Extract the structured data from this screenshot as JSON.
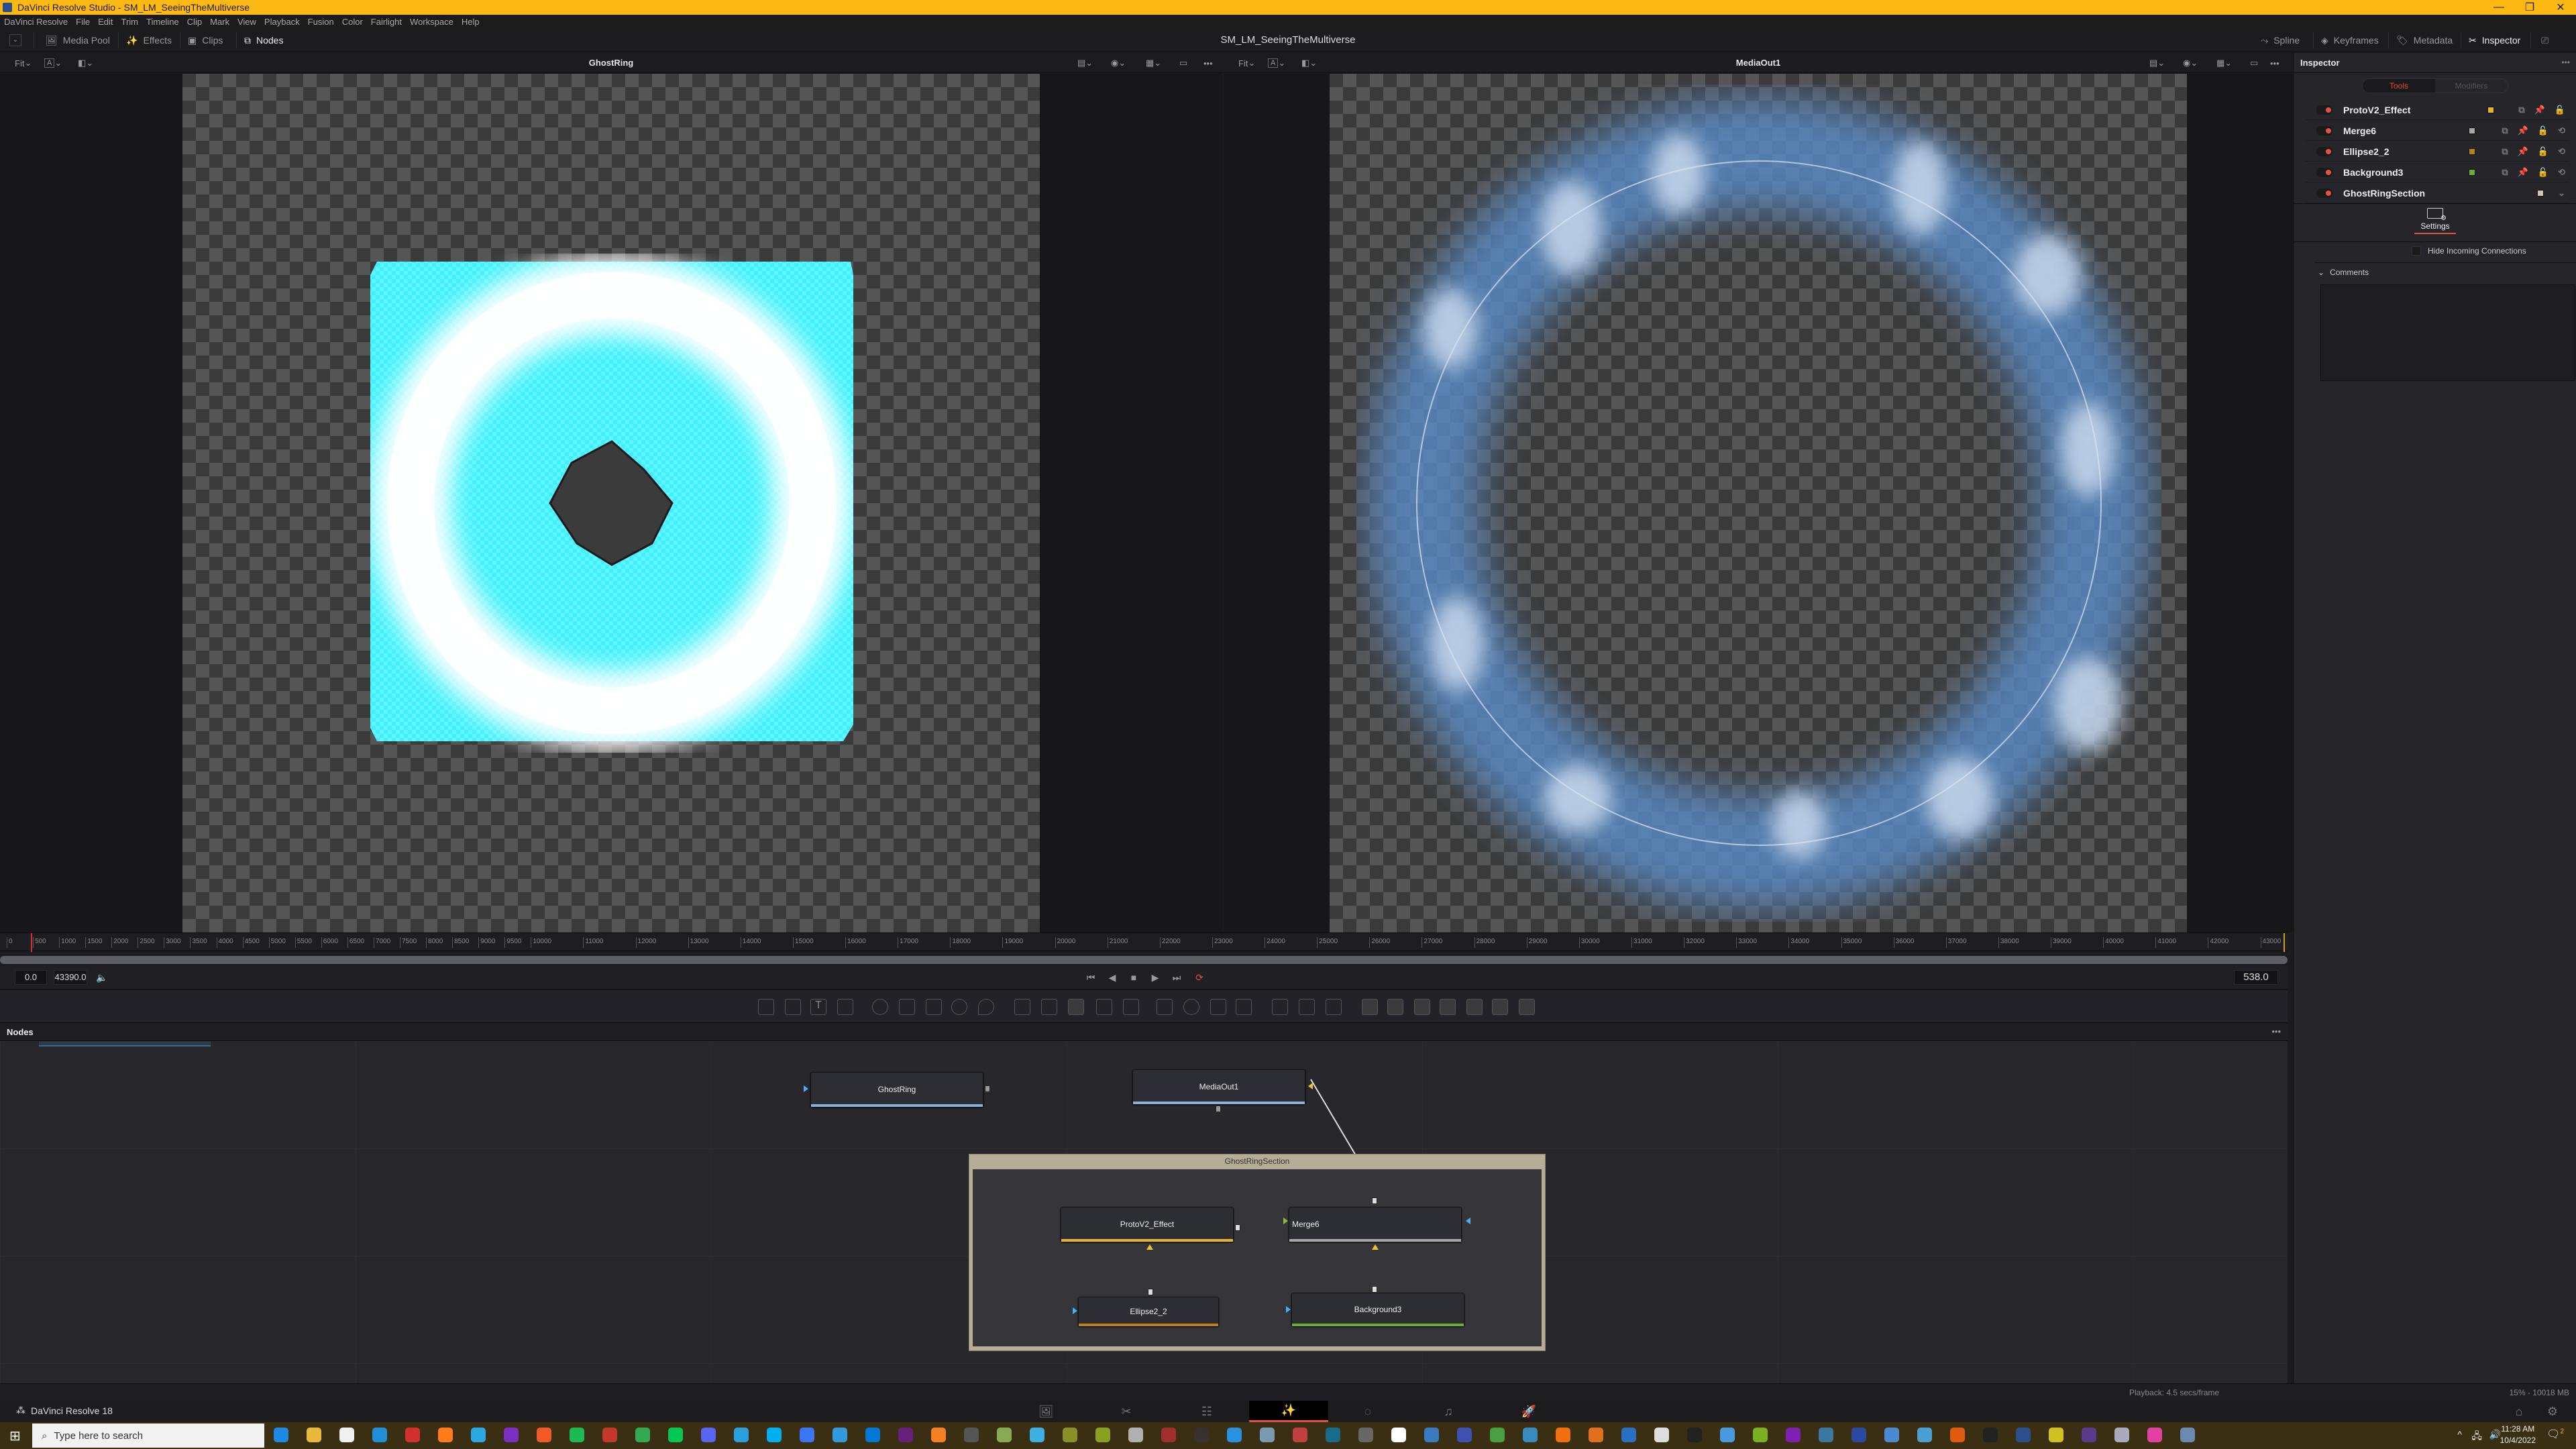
{
  "window": {
    "title": "DaVinci Resolve Studio - SM_LM_SeeingTheMultiverse",
    "minimize": "—",
    "maximize": "❐",
    "close": "✕"
  },
  "menu": [
    "DaVinci Resolve",
    "File",
    "Edit",
    "Trim",
    "Timeline",
    "Clip",
    "Mark",
    "View",
    "Playback",
    "Fusion",
    "Color",
    "Fairlight",
    "Workspace",
    "Help"
  ],
  "toolbar": {
    "media_pool": "Media Pool",
    "effects": "Effects",
    "clips": "Clips",
    "nodes": "Nodes",
    "project_title": "SM_LM_SeeingTheMultiverse",
    "spline": "Spline",
    "keyframes": "Keyframes",
    "metadata": "Metadata",
    "inspector": "Inspector"
  },
  "viewer_left": {
    "title": "GhostRing",
    "fit": "Fit",
    "channel": "A"
  },
  "viewer_right": {
    "title": "MediaOut1",
    "fit": "Fit",
    "channel": "A",
    "more": "•••"
  },
  "ruler": {
    "ticks": [
      "0",
      "500",
      "1000",
      "1500",
      "2000",
      "2500",
      "3000",
      "3500",
      "4000",
      "4500",
      "5000",
      "5500",
      "6000",
      "6500",
      "7000",
      "7500",
      "8000",
      "8500",
      "9000",
      "9500",
      "10000",
      "11000",
      "12000",
      "13000",
      "14000",
      "15000",
      "16000",
      "17000",
      "18000",
      "19000",
      "20000",
      "21000",
      "22000",
      "23000",
      "24000",
      "25000",
      "26000",
      "27000",
      "28000",
      "29000",
      "30000",
      "31000",
      "32000",
      "33000",
      "34000",
      "35000",
      "36000",
      "37000",
      "38000",
      "39000",
      "40000",
      "41000",
      "42000",
      "43000"
    ]
  },
  "transport": {
    "start": "0.0",
    "end": "43390.0",
    "current": "538.0",
    "go_start": "⏮",
    "step_back": "◀",
    "stop": "■",
    "step_fwd": "▶",
    "go_end": "⏭",
    "loop": "⟳"
  },
  "nodes_panel": {
    "title": "Nodes",
    "more": "•••",
    "nodes": [
      {
        "name": "GhostRing"
      },
      {
        "name": "MediaOut1"
      },
      {
        "name": "ProtoV2_Effect"
      },
      {
        "name": "Merge6"
      },
      {
        "name": "Ellipse2_2"
      },
      {
        "name": "Background3"
      }
    ],
    "group": {
      "name": "GhostRingSection"
    }
  },
  "inspector": {
    "title": "Inspector",
    "more": "•••",
    "tabs": [
      "Tools",
      "Modifiers"
    ],
    "tools": [
      {
        "name": "ProtoV2_Effect",
        "color": "#e8b422"
      },
      {
        "name": "Merge6",
        "color": "#a8a8a8"
      },
      {
        "name": "Ellipse2_2",
        "color": "#b8820f"
      },
      {
        "name": "Background3",
        "color": "#6ab02e"
      },
      {
        "name": "GhostRingSection",
        "color": "#cfc8b4"
      }
    ],
    "settings_tab": "Settings",
    "hide_incoming": "Hide Incoming Connections",
    "comments": "Comments"
  },
  "status": {
    "playback": "Playback: 4.5 secs/frame",
    "memory": "15% - 10018 MB",
    "app_name": "DaVinci Resolve 18"
  },
  "taskbar": {
    "search_placeholder": "Type here to search",
    "time": "11:28 AM",
    "date": "10/4/2022",
    "notifications": "2"
  },
  "colors": {
    "accent": "#fdb913",
    "active_red": "#e05040",
    "link": "#4ab0f0"
  }
}
